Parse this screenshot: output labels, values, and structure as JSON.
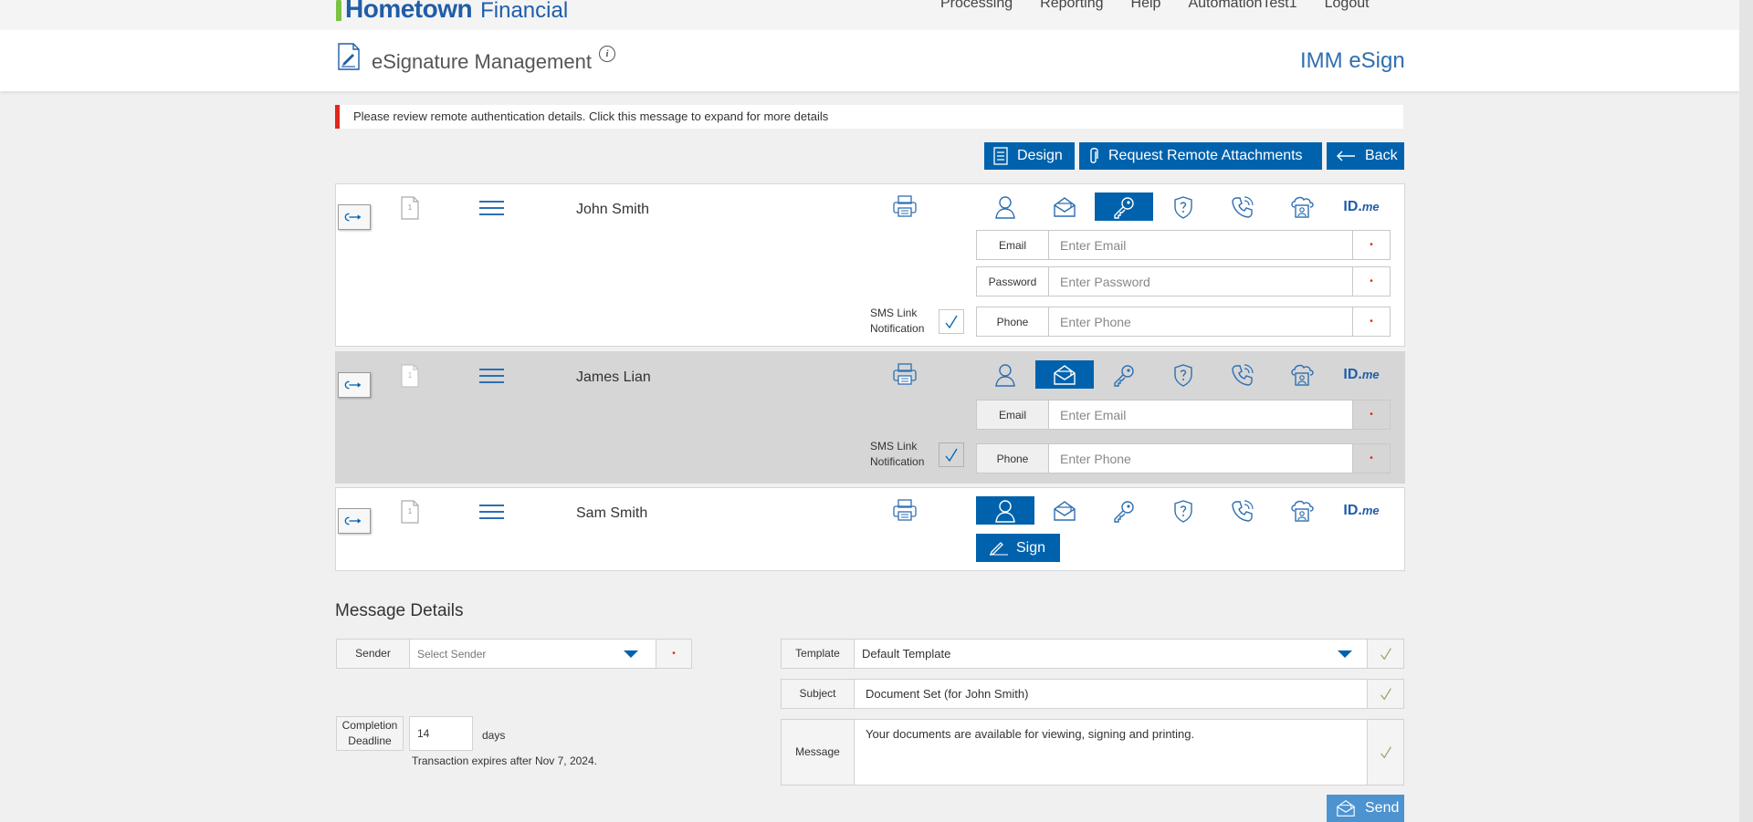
{
  "brand": {
    "name": "Hometown",
    "suffix": "Financial"
  },
  "topnav": [
    "Processing",
    "Reporting",
    "Help",
    "AutomationTest1",
    "Logout"
  ],
  "header": {
    "title": "eSignature Management",
    "app_name": "IMM eSign"
  },
  "alert": "Please review remote authentication details. Click this message to expand for more details",
  "actions": {
    "design": "Design",
    "remote_attachments": "Request Remote Attachments",
    "back": "Back"
  },
  "auth_methods": [
    "person-icon",
    "email-envelope-icon",
    "key-icon",
    "shield-question-icon",
    "phone-icon",
    "cloud-id-card-icon",
    "idme-icon"
  ],
  "idme": {
    "id": "ID.",
    "me": "me"
  },
  "signers": [
    {
      "name": "John Smith",
      "page_number": "1",
      "selected_method": "key-icon",
      "fields": [
        {
          "label": "Email",
          "placeholder": "Enter Email"
        },
        {
          "label": "Password",
          "placeholder": "Enter Password"
        },
        {
          "label": "Phone",
          "placeholder": "Enter Phone"
        }
      ],
      "sms": {
        "line1": "SMS Link",
        "line2": "Notification",
        "checked": true
      }
    },
    {
      "name": "James Lian",
      "page_number": "1",
      "selected_method": "email-envelope-icon",
      "fields": [
        {
          "label": "Email",
          "placeholder": "Enter Email"
        },
        {
          "label": "Phone",
          "placeholder": "Enter Phone"
        }
      ],
      "sms": {
        "line1": "SMS Link",
        "line2": "Notification",
        "checked": true
      }
    },
    {
      "name": "Sam Smith",
      "page_number": "1",
      "selected_method": "person-icon",
      "sign_label": "Sign"
    }
  ],
  "message_details": {
    "title": "Message Details",
    "sender_label": "Sender",
    "sender_placeholder": "Select Sender",
    "deadline_label_1": "Completion",
    "deadline_label_2": "Deadline",
    "deadline_value": "14",
    "deadline_unit": "days",
    "expires_note": "Transaction expires after Nov 7, 2024.",
    "template_label": "Template",
    "template_value": "Default Template",
    "subject_label": "Subject",
    "subject_value": "Document Set (for John Smith)",
    "message_label": "Message",
    "message_value": "Your documents are available for viewing, signing and printing.",
    "send_label": "Send"
  },
  "colors": {
    "primary": "#0062ad",
    "brand_blue": "#1f5da8",
    "alert_red": "#e1261c",
    "logo_green": "#7cc242"
  }
}
